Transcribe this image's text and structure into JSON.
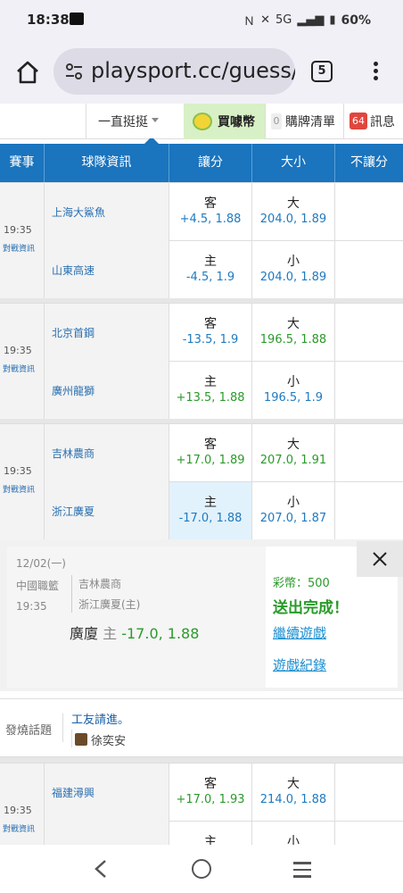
{
  "status": {
    "time": "18:38",
    "network": "5G",
    "battery": "60%"
  },
  "browser": {
    "url": "playsport.cc/guess/",
    "tab_count": "5"
  },
  "subnav": {
    "filter": "一直挺挺",
    "buy_coins": "買噱幣",
    "cart_count": "0",
    "cart": "購牌清單",
    "msg_count": "64",
    "messages": "訊息"
  },
  "table": {
    "headers": [
      "賽事",
      "球隊資訊",
      "讓分",
      "大小",
      "不讓分"
    ]
  },
  "games": [
    {
      "time": "19:35",
      "info": "對戰資訊",
      "away": {
        "team": "上海大鯊魚",
        "spread_side": "客",
        "spread": "+4.5, 1.88",
        "total_side": "大",
        "total": "204.0, 1.89"
      },
      "home": {
        "team": "山東高速",
        "spread_side": "主",
        "spread": "-4.5, 1.9",
        "total_side": "小",
        "total": "204.0, 1.89"
      }
    },
    {
      "time": "19:35",
      "info": "對戰資訊",
      "away": {
        "team": "北京首鋼",
        "spread_side": "客",
        "spread": "-13.5, 1.9",
        "total_side": "大",
        "total": "196.5, 1.88"
      },
      "home": {
        "team": "廣州龍獅",
        "spread_side": "主",
        "spread": "+13.5, 1.88",
        "total_side": "小",
        "total": "196.5, 1.9"
      }
    },
    {
      "time": "19:35",
      "info": "對戰資訊",
      "away": {
        "team": "吉林農商",
        "spread_side": "客",
        "spread": "+17.0, 1.89",
        "total_side": "大",
        "total": "207.0, 1.91"
      },
      "home": {
        "team": "浙江廣夏",
        "spread_side": "主",
        "spread": "-17.0, 1.88",
        "total_side": "小",
        "total": "207.0, 1.87"
      }
    },
    {
      "time": "19:35",
      "info": "對戰資訊",
      "away": {
        "team": "福建潯興",
        "spread_side": "客",
        "spread": "+17.0, 1.93",
        "total_side": "大",
        "total": "214.0, 1.88"
      },
      "home": {
        "team": "",
        "spread_side": "主",
        "spread": "",
        "total_side": "小",
        "total": ""
      }
    }
  ],
  "popup": {
    "date": "12/02(一)",
    "league": "中國職籃",
    "time": "19:35",
    "away": "吉林農商",
    "home": "浙江廣夏(主)",
    "bet_team": "廣廈",
    "bet_side": "主",
    "bet_odds": "-17.0, 1.88",
    "coins": "彩幣：500",
    "done": "送出完成！",
    "continue": "繼續遊戲",
    "records": "遊戲紀錄"
  },
  "hot_topic": {
    "label": "發燒話題",
    "title": "工友請進。",
    "author": "徐奕安"
  }
}
